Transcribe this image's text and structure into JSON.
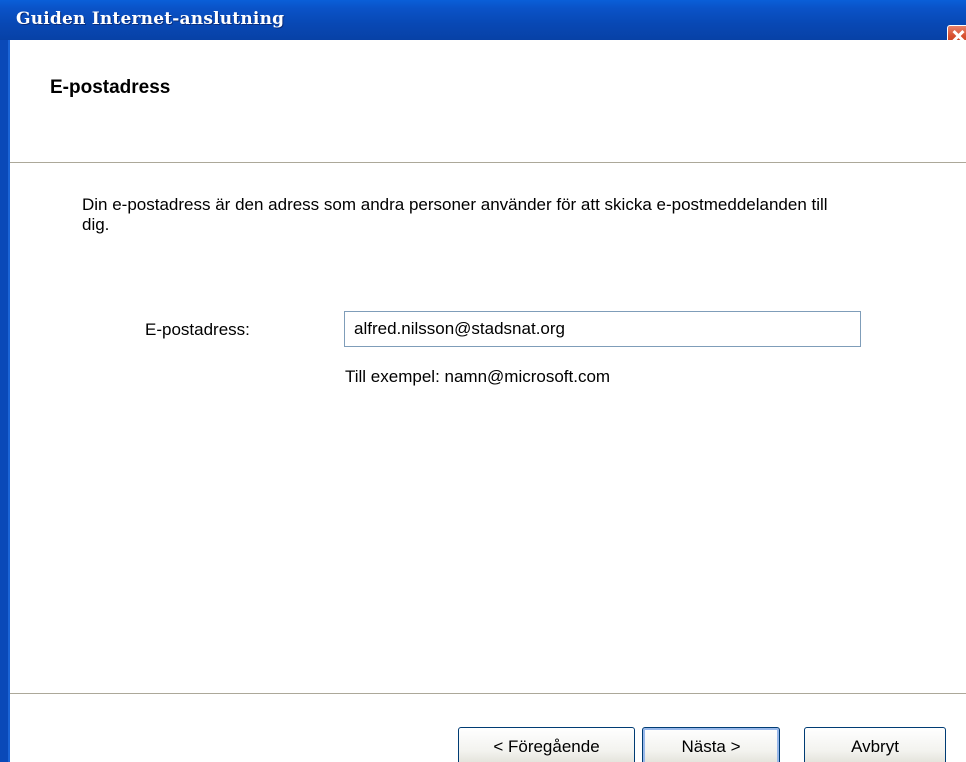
{
  "window": {
    "title": "Guiden Internet-anslutning"
  },
  "header": {
    "title": "E-postadress"
  },
  "body": {
    "description": "Din e-postadress är den adress som andra personer använder för att skicka e-postmeddelanden till dig.",
    "email_label": "E-postadress:",
    "email_value": "alfred.nilsson@stadsnat.org",
    "example": "Till exempel: namn@microsoft.com"
  },
  "buttons": {
    "prev": "< Föregående",
    "next": "Nästa >",
    "cancel": "Avbryt"
  },
  "icons": {
    "close": "close-icon"
  },
  "colors": {
    "titlebar": "#0a53c8",
    "close": "#d7502f",
    "input_border": "#7f9db9"
  }
}
